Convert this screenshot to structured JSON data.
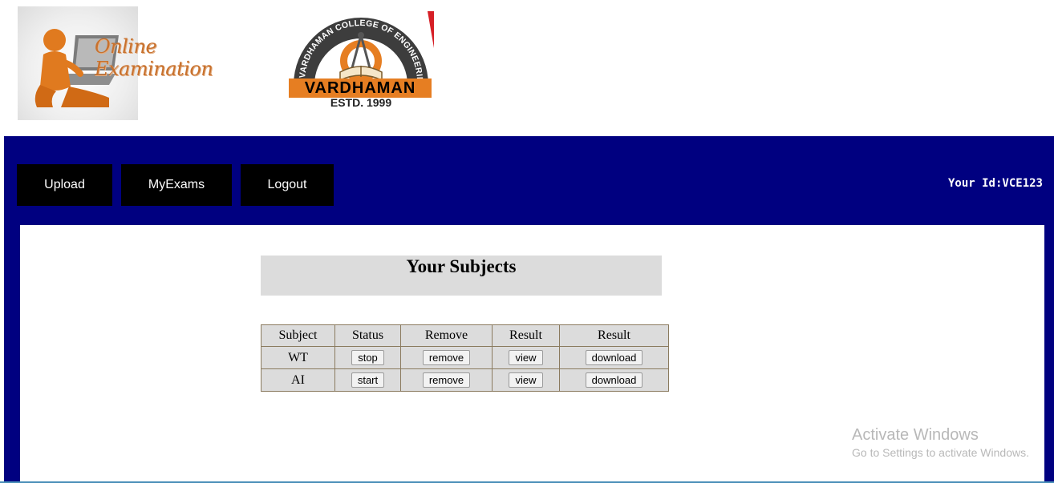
{
  "header": {
    "exam_logo_text": "Online Examination",
    "college_logo": {
      "arc_text": "VARDHAMAN COLLEGE OF ENGINEERING",
      "band_text": "VARDHAMAN",
      "estd_text": "ESTD. 1999"
    }
  },
  "nav": {
    "items": [
      {
        "label": "Upload"
      },
      {
        "label": "MyExams"
      },
      {
        "label": "Logout"
      }
    ],
    "user_id": "Your Id:VCE123"
  },
  "main": {
    "title": "Your Subjects",
    "table": {
      "headers": [
        "Subject",
        "Status",
        "Remove",
        "Result",
        "Result"
      ],
      "rows": [
        {
          "subject": "WT",
          "status_btn": "stop",
          "remove_btn": "remove",
          "view_btn": "view",
          "download_btn": "download"
        },
        {
          "subject": "AI",
          "status_btn": "start",
          "remove_btn": "remove",
          "view_btn": "view",
          "download_btn": "download"
        }
      ]
    }
  },
  "watermark": {
    "line1": "Activate Windows",
    "line2": "Go to Settings to activate Windows."
  },
  "colors": {
    "frame": "#000080",
    "nav_button": "#000000",
    "panel_gray": "#dcdcdc"
  }
}
